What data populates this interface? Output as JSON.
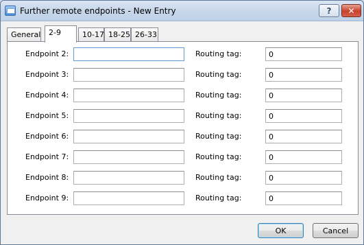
{
  "window": {
    "title": "Further remote endpoints - New Entry",
    "help_label": "?",
    "close_label": "✕"
  },
  "tabs": [
    {
      "label": "General"
    },
    {
      "label": "2-9"
    },
    {
      "label": "10-17"
    },
    {
      "label": "18-25"
    },
    {
      "label": "26-33"
    }
  ],
  "rows": [
    {
      "endpoint_label": "Endpoint 2:",
      "endpoint_value": "",
      "routing_label": "Routing tag:",
      "routing_value": "0"
    },
    {
      "endpoint_label": "Endpoint 3:",
      "endpoint_value": "",
      "routing_label": "Routing tag:",
      "routing_value": "0"
    },
    {
      "endpoint_label": "Endpoint 4:",
      "endpoint_value": "",
      "routing_label": "Routing tag:",
      "routing_value": "0"
    },
    {
      "endpoint_label": "Endpoint 5:",
      "endpoint_value": "",
      "routing_label": "Routing tag:",
      "routing_value": "0"
    },
    {
      "endpoint_label": "Endpoint 6:",
      "endpoint_value": "",
      "routing_label": "Routing tag:",
      "routing_value": "0"
    },
    {
      "endpoint_label": "Endpoint 7:",
      "endpoint_value": "",
      "routing_label": "Routing tag:",
      "routing_value": "0"
    },
    {
      "endpoint_label": "Endpoint 8:",
      "endpoint_value": "",
      "routing_label": "Routing tag:",
      "routing_value": "0"
    },
    {
      "endpoint_label": "Endpoint 9:",
      "endpoint_value": "",
      "routing_label": "Routing tag:",
      "routing_value": "0"
    }
  ],
  "buttons": {
    "ok": "OK",
    "cancel": "Cancel"
  },
  "colors": {
    "titlebar": "#c7d7ea",
    "close_button": "#c7412c",
    "focus_border": "#5d9bd8"
  }
}
